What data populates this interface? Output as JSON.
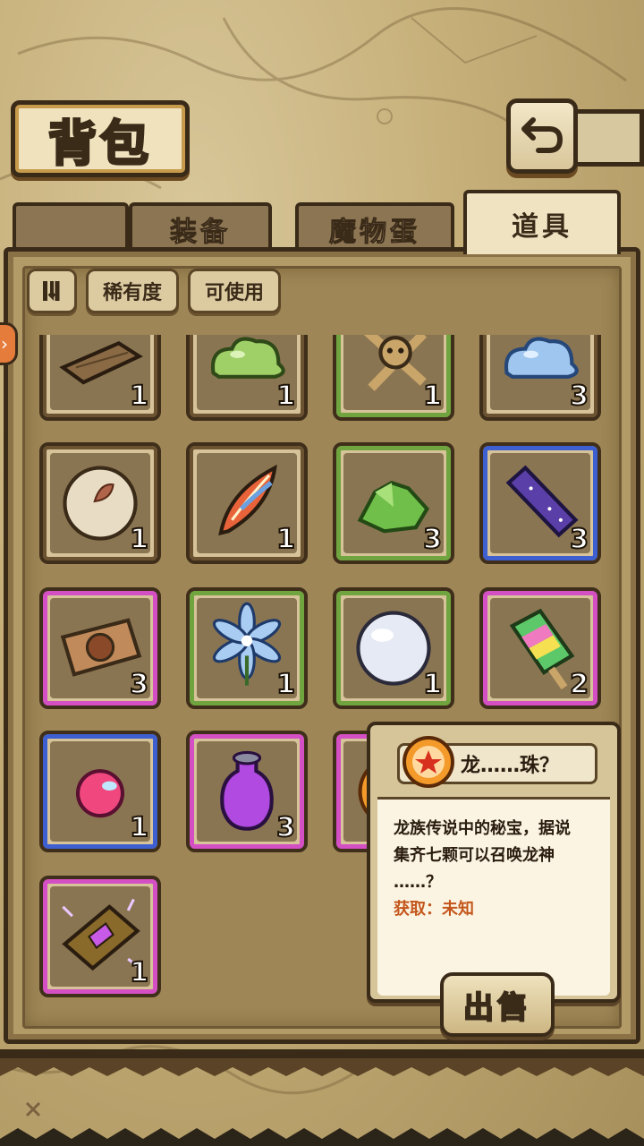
{
  "header": {
    "title": "背包"
  },
  "tabs": [
    {
      "label": "装备",
      "active": false
    },
    {
      "label": "魔物蛋",
      "active": false
    },
    {
      "label": "道具",
      "active": true
    }
  ],
  "filters": {
    "sort_icon": "sort-toggle-icon",
    "rarity_label": "稀有度",
    "usable_label": "可使用"
  },
  "items": [
    {
      "icon": "wood-plank-icon",
      "count": "1",
      "rarity": "plain"
    },
    {
      "icon": "green-slime-icon",
      "count": "1",
      "rarity": "plain"
    },
    {
      "icon": "voodoo-doll-icon",
      "count": "1",
      "rarity": "green"
    },
    {
      "icon": "blue-slime-icon",
      "count": "3",
      "rarity": "plain"
    },
    {
      "icon": "seed-orb-icon",
      "count": "1",
      "rarity": "plain"
    },
    {
      "icon": "phoenix-feather-icon",
      "count": "1",
      "rarity": "plain"
    },
    {
      "icon": "green-crystal-icon",
      "count": "3",
      "rarity": "green"
    },
    {
      "icon": "starry-bar-icon",
      "count": "3",
      "rarity": "blue"
    },
    {
      "icon": "card-ticket-icon",
      "count": "3",
      "rarity": "pink"
    },
    {
      "icon": "blue-flower-icon",
      "count": "1",
      "rarity": "green"
    },
    {
      "icon": "pearl-icon",
      "count": "1",
      "rarity": "green"
    },
    {
      "icon": "rainbow-popsicle-icon",
      "count": "2",
      "rarity": "pink"
    },
    {
      "icon": "pink-gem-icon",
      "count": "1",
      "rarity": "blue"
    },
    {
      "icon": "purple-potion-icon",
      "count": "3",
      "rarity": "pink"
    },
    {
      "icon": "dragon-ball-icon",
      "count": "",
      "rarity": "pink"
    },
    {
      "icon": "magic-book-icon",
      "count": "1",
      "rarity": "pink"
    }
  ],
  "tooltip": {
    "name": "龙……珠？",
    "icon": "dragon-ball-icon",
    "description_lines": [
      "龙族传说中的秘宝，据说",
      "集齐七颗可以召唤龙神",
      "……？"
    ],
    "source": "获取：未知",
    "sell_label": "出售"
  },
  "colors": {
    "green": "#6fa43e",
    "blue": "#3e5fd0",
    "pink": "#d44fc4",
    "source_text": "#c4561c"
  }
}
